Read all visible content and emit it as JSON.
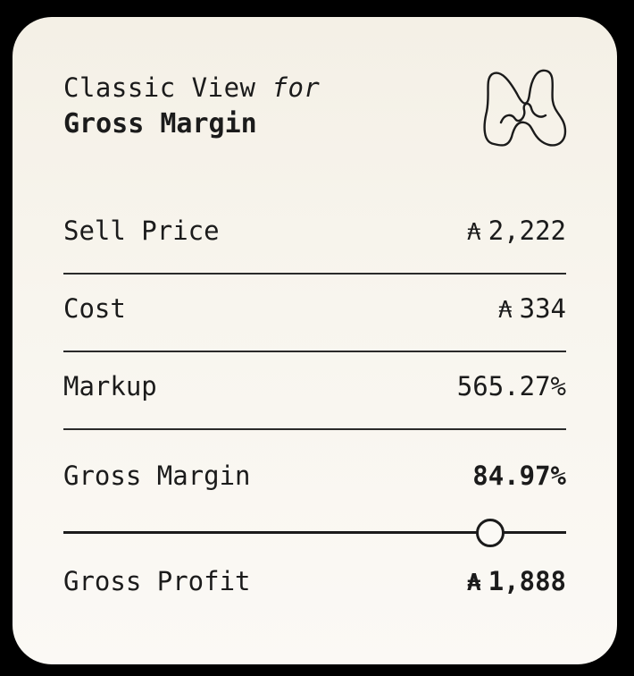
{
  "header": {
    "title_prefix": "Classic View",
    "title_connector": "for",
    "subject": "Gross Margin",
    "logo_icon": "squiggle-m-logo-icon"
  },
  "rows": {
    "sell_price": {
      "label": "Sell Price",
      "currency": "₳",
      "value": "2,222"
    },
    "cost": {
      "label": "Cost",
      "currency": "₳",
      "value": "334"
    },
    "markup": {
      "label": "Markup",
      "value": "565.27%"
    },
    "gross_margin": {
      "label": "Gross Margin",
      "value": "84.97%"
    },
    "gross_profit": {
      "label": "Gross Profit",
      "currency": "₳",
      "value": "1,888"
    }
  },
  "slider": {
    "metric": "Gross Margin",
    "level": 0.8497
  },
  "colors": {
    "background": "#000000",
    "card": "#f8f5ee",
    "text": "#1b1b1b"
  }
}
